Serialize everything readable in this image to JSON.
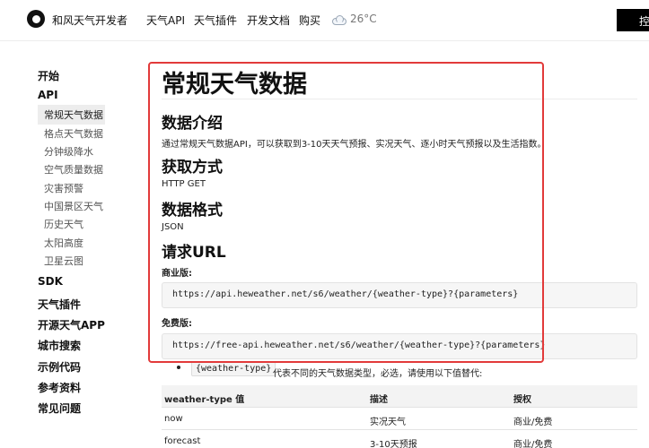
{
  "header": {
    "brand": "和风天气开发者",
    "nav": [
      "天气API",
      "天气插件",
      "开发文档",
      "购买"
    ],
    "weather_temp": "26°C",
    "console_label": "控"
  },
  "sidebar": {
    "groups": {
      "start": "开始",
      "api": "API",
      "sdk": "SDK",
      "plugin": "天气插件",
      "opensource": "开源天气APP",
      "city": "城市搜索",
      "examples": "示例代码",
      "reference": "参考资料",
      "faq": "常见问题"
    },
    "api_items": [
      "常规天气数据",
      "格点天气数据",
      "分钟级降水",
      "空气质量数据",
      "灾害预警",
      "中国景区天气",
      "历史天气",
      "太阳高度",
      "卫星云图"
    ]
  },
  "main": {
    "title": "常规天气数据",
    "intro_heading": "数据介绍",
    "intro_text": "通过常规天气数据API，可以获取到3-10天天气预报、实况天气、逐小时天气预报以及生活指数。",
    "method_heading": "获取方式",
    "method_text": "HTTP GET",
    "format_heading": "数据格式",
    "format_text": "JSON",
    "url_heading": "请求URL",
    "commercial_label": "商业版:",
    "commercial_url": "https://api.heweather.net/s6/weather/{weather-type}?{parameters}",
    "free_label": "免费版:",
    "free_url": "https://free-api.heweather.net/s6/weather/{weather-type}?{parameters}",
    "bullet_code": "{weather-type}",
    "bullet_text": "代表不同的天气数据类型，必选，请使用以下值替代:",
    "table": {
      "headers": [
        "weather-type 值",
        "描述",
        "授权"
      ],
      "rows": [
        [
          "now",
          "实况天气",
          "商业/免费"
        ],
        [
          "forecast",
          "3-10天预报",
          "商业/免费"
        ]
      ]
    }
  },
  "colors": {
    "highlight": "#e23a3a",
    "console_bg": "#000000"
  }
}
